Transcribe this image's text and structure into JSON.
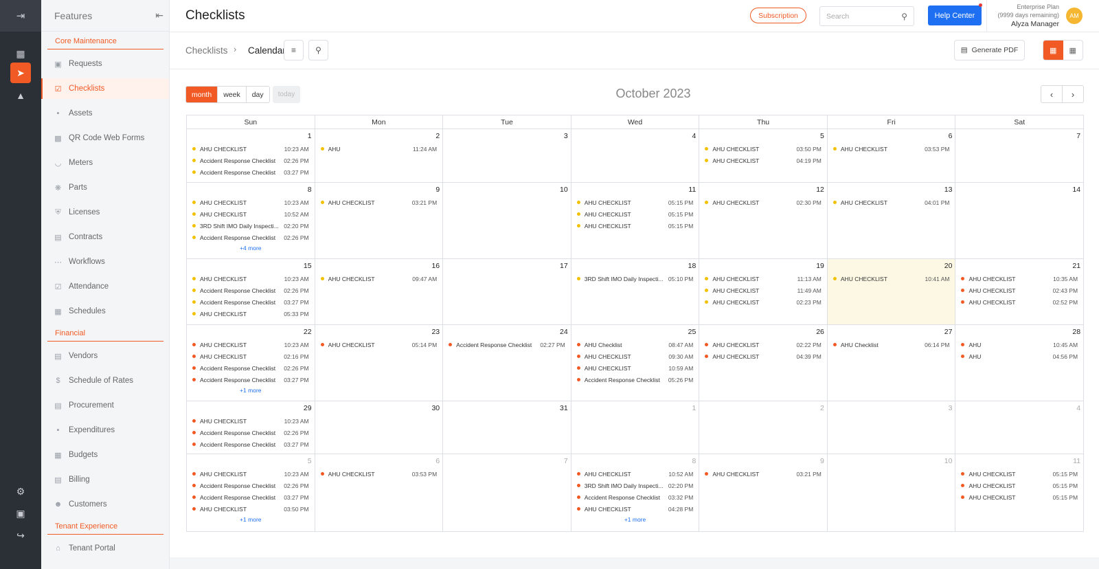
{
  "sidebar": {
    "header": "Features",
    "sections": {
      "core": "Core Maintenance",
      "financial": "Financial",
      "tenant": "Tenant Experience"
    },
    "items": [
      {
        "label": "Requests",
        "icon": "request-icon"
      },
      {
        "label": "Checklists",
        "icon": "checklist-icon",
        "active": true
      },
      {
        "label": "Assets",
        "icon": "asset-icon"
      },
      {
        "label": "QR Code Web Forms",
        "icon": "qr-icon"
      },
      {
        "label": "Meters",
        "icon": "meter-icon"
      },
      {
        "label": "Parts",
        "icon": "parts-icon"
      },
      {
        "label": "Licenses",
        "icon": "license-icon"
      },
      {
        "label": "Contracts",
        "icon": "contract-icon"
      },
      {
        "label": "Workflows",
        "icon": "workflow-icon"
      },
      {
        "label": "Attendance",
        "icon": "attendance-icon"
      },
      {
        "label": "Schedules",
        "icon": "schedule-icon"
      },
      {
        "label": "Vendors",
        "icon": "vendor-icon"
      },
      {
        "label": "Schedule of Rates",
        "icon": "dollar-icon"
      },
      {
        "label": "Procurement",
        "icon": "procurement-icon"
      },
      {
        "label": "Expenditures",
        "icon": "expenditure-icon"
      },
      {
        "label": "Budgets",
        "icon": "budget-icon"
      },
      {
        "label": "Billing",
        "icon": "billing-icon"
      },
      {
        "label": "Customers",
        "icon": "customers-icon"
      },
      {
        "label": "Tenant Portal",
        "icon": "tenant-portal-icon"
      }
    ]
  },
  "topbar": {
    "title": "Checklists",
    "subscription": "Subscription",
    "search_placeholder": "Search",
    "help": "Help Center",
    "plan": "Enterprise Plan",
    "days": "(9999 days remaining)",
    "user": "Alyza Manager",
    "initials": "AM"
  },
  "subheader": {
    "crumb_parent": "Checklists",
    "crumb_current": "Calendar",
    "generate_pdf": "Generate PDF"
  },
  "calendar": {
    "modes": [
      "month",
      "week",
      "day"
    ],
    "today": "today",
    "title": "October 2023",
    "weekdays": [
      "Sun",
      "Mon",
      "Tue",
      "Wed",
      "Thu",
      "Fri",
      "Sat"
    ],
    "weeks": [
      [
        {
          "n": "1",
          "ev": [
            [
              "AHU CHECKLIST",
              "10:23 AM",
              "y"
            ],
            [
              "Accident Response Checklist",
              "02:26 PM",
              "y"
            ],
            [
              "Accident Response Checklist",
              "03:27 PM",
              "y"
            ]
          ]
        },
        {
          "n": "2",
          "ev": [
            [
              "AHU",
              "11:24 AM",
              "y"
            ]
          ]
        },
        {
          "n": "3",
          "ev": []
        },
        {
          "n": "4",
          "ev": []
        },
        {
          "n": "5",
          "ev": [
            [
              "AHU CHECKLIST",
              "03:50 PM",
              "y"
            ],
            [
              "AHU CHECKLIST",
              "04:19 PM",
              "y"
            ]
          ]
        },
        {
          "n": "6",
          "ev": [
            [
              "AHU CHECKLIST",
              "03:53 PM",
              "y"
            ]
          ]
        },
        {
          "n": "7",
          "ev": []
        }
      ],
      [
        {
          "n": "8",
          "ev": [
            [
              "AHU CHECKLIST",
              "10:23 AM",
              "y"
            ],
            [
              "AHU CHECKLIST",
              "10:52 AM",
              "y"
            ],
            [
              "3RD Shift IMO Daily Inspecti...",
              "02:20 PM",
              "y"
            ],
            [
              "Accident Response Checklist",
              "02:26 PM",
              "y"
            ]
          ],
          "more": "+4 more"
        },
        {
          "n": "9",
          "ev": [
            [
              "AHU CHECKLIST",
              "03:21 PM",
              "y"
            ]
          ]
        },
        {
          "n": "10",
          "ev": []
        },
        {
          "n": "11",
          "ev": [
            [
              "AHU CHECKLIST",
              "05:15 PM",
              "y"
            ],
            [
              "AHU CHECKLIST",
              "05:15 PM",
              "y"
            ],
            [
              "AHU CHECKLIST",
              "05:15 PM",
              "y"
            ]
          ]
        },
        {
          "n": "12",
          "ev": [
            [
              "AHU CHECKLIST",
              "02:30 PM",
              "y"
            ]
          ]
        },
        {
          "n": "13",
          "ev": [
            [
              "AHU CHECKLIST",
              "04:01 PM",
              "y"
            ]
          ]
        },
        {
          "n": "14",
          "ev": []
        }
      ],
      [
        {
          "n": "15",
          "ev": [
            [
              "AHU CHECKLIST",
              "10:23 AM",
              "y"
            ],
            [
              "Accident Response Checklist",
              "02:26 PM",
              "y"
            ],
            [
              "Accident Response Checklist",
              "03:27 PM",
              "y"
            ],
            [
              "AHU CHECKLIST",
              "05:33 PM",
              "y"
            ]
          ]
        },
        {
          "n": "16",
          "ev": [
            [
              "AHU CHECKLIST",
              "09:47 AM",
              "y"
            ]
          ]
        },
        {
          "n": "17",
          "ev": []
        },
        {
          "n": "18",
          "ev": [
            [
              "3RD Shift IMO Daily Inspecti...",
              "05:10 PM",
              "y"
            ]
          ]
        },
        {
          "n": "19",
          "ev": [
            [
              "AHU CHECKLIST",
              "11:13 AM",
              "y"
            ],
            [
              "AHU CHECKLIST",
              "11:49 AM",
              "y"
            ],
            [
              "AHU CHECKLIST",
              "02:23 PM",
              "y"
            ]
          ]
        },
        {
          "n": "20",
          "today": true,
          "ev": [
            [
              "AHU CHECKLIST",
              "10:41 AM",
              "y"
            ]
          ]
        },
        {
          "n": "21",
          "ev": [
            [
              "AHU CHECKLIST",
              "10:35 AM",
              "r"
            ],
            [
              "AHU CHECKLIST",
              "02:43 PM",
              "r"
            ],
            [
              "AHU CHECKLIST",
              "02:52 PM",
              "r"
            ]
          ]
        }
      ],
      [
        {
          "n": "22",
          "ev": [
            [
              "AHU CHECKLIST",
              "10:23 AM",
              "r"
            ],
            [
              "AHU CHECKLIST",
              "02:16 PM",
              "r"
            ],
            [
              "Accident Response Checklist",
              "02:26 PM",
              "r"
            ],
            [
              "Accident Response Checklist",
              "03:27 PM",
              "r"
            ]
          ],
          "more": "+1 more"
        },
        {
          "n": "23",
          "ev": [
            [
              "AHU CHECKLIST",
              "05:14 PM",
              "r"
            ]
          ]
        },
        {
          "n": "24",
          "ev": [
            [
              "Accident Response Checklist",
              "02:27 PM",
              "r"
            ]
          ]
        },
        {
          "n": "25",
          "ev": [
            [
              "AHU Checklist",
              "08:47 AM",
              "r"
            ],
            [
              "AHU CHECKLIST",
              "09:30 AM",
              "r"
            ],
            [
              "AHU CHECKLIST",
              "10:59 AM",
              "r"
            ],
            [
              "Accident Response Checklist",
              "05:26 PM",
              "r"
            ]
          ]
        },
        {
          "n": "26",
          "ev": [
            [
              "AHU CHECKLIST",
              "02:22 PM",
              "r"
            ],
            [
              "AHU CHECKLIST",
              "04:39 PM",
              "r"
            ]
          ]
        },
        {
          "n": "27",
          "ev": [
            [
              "AHU Checklist",
              "06:14 PM",
              "r"
            ]
          ]
        },
        {
          "n": "28",
          "ev": [
            [
              "AHU",
              "10:45 AM",
              "r"
            ],
            [
              "AHU",
              "04:56 PM",
              "r"
            ]
          ]
        }
      ],
      [
        {
          "n": "29",
          "ev": [
            [
              "AHU CHECKLIST",
              "10:23 AM",
              "r"
            ],
            [
              "Accident Response Checklist",
              "02:26 PM",
              "r"
            ],
            [
              "Accident Response Checklist",
              "03:27 PM",
              "r"
            ]
          ]
        },
        {
          "n": "30",
          "ev": []
        },
        {
          "n": "31",
          "ev": []
        },
        {
          "n": "1",
          "other": true,
          "ev": []
        },
        {
          "n": "2",
          "other": true,
          "ev": []
        },
        {
          "n": "3",
          "other": true,
          "ev": []
        },
        {
          "n": "4",
          "other": true,
          "ev": []
        }
      ],
      [
        {
          "n": "5",
          "other": true,
          "ev": [
            [
              "AHU CHECKLIST",
              "10:23 AM",
              "r"
            ],
            [
              "Accident Response Checklist",
              "02:26 PM",
              "r"
            ],
            [
              "Accident Response Checklist",
              "03:27 PM",
              "r"
            ],
            [
              "AHU CHECKLIST",
              "03:50 PM",
              "r"
            ]
          ],
          "more": "+1 more"
        },
        {
          "n": "6",
          "other": true,
          "ev": [
            [
              "AHU CHECKLIST",
              "03:53 PM",
              "r"
            ]
          ]
        },
        {
          "n": "7",
          "other": true,
          "ev": []
        },
        {
          "n": "8",
          "other": true,
          "ev": [
            [
              "AHU CHECKLIST",
              "10:52 AM",
              "r"
            ],
            [
              "3RD Shift IMO Daily Inspecti...",
              "02:20 PM",
              "r"
            ],
            [
              "Accident Response Checklist",
              "03:32 PM",
              "r"
            ],
            [
              "AHU CHECKLIST",
              "04:28 PM",
              "r"
            ]
          ],
          "more": "+1 more"
        },
        {
          "n": "9",
          "other": true,
          "ev": [
            [
              "AHU CHECKLIST",
              "03:21 PM",
              "r"
            ]
          ]
        },
        {
          "n": "10",
          "other": true,
          "ev": []
        },
        {
          "n": "11",
          "other": true,
          "ev": [
            [
              "AHU CHECKLIST",
              "05:15 PM",
              "r"
            ],
            [
              "AHU CHECKLIST",
              "05:15 PM",
              "r"
            ],
            [
              "AHU CHECKLIST",
              "05:15 PM",
              "r"
            ]
          ]
        }
      ]
    ]
  },
  "colors": {
    "accent": "#f15a24",
    "primary_blue": "#1e6ff1",
    "dot_yellow": "#f2c200",
    "dot_red": "#f15a24",
    "today_bg": "#fcf8e3"
  }
}
